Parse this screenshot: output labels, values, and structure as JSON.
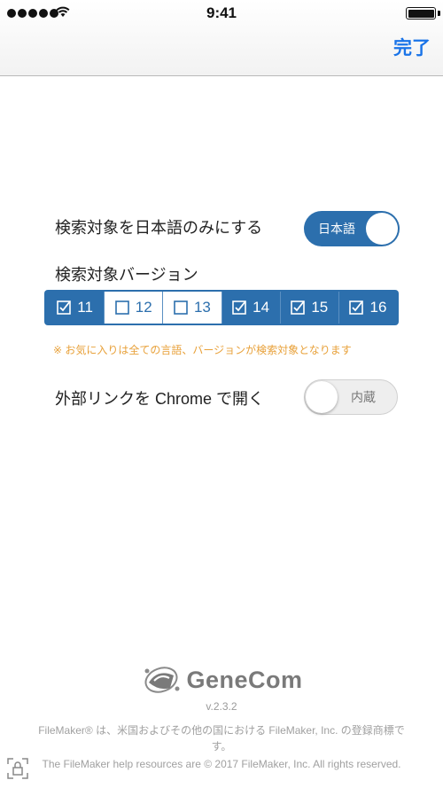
{
  "status_bar": {
    "time": "9:41"
  },
  "nav": {
    "done_label": "完了"
  },
  "settings": {
    "japanese_only": {
      "label": "検索対象を日本語のみにする",
      "toggle_text": "日本語",
      "state": "on"
    },
    "versions": {
      "label": "検索対象バージョン",
      "items": [
        {
          "label": "11",
          "checked": true
        },
        {
          "label": "12",
          "checked": false
        },
        {
          "label": "13",
          "checked": false
        },
        {
          "label": "14",
          "checked": true
        },
        {
          "label": "15",
          "checked": true
        },
        {
          "label": "16",
          "checked": true
        }
      ]
    },
    "note": "※ お気に入りは全ての言語、バージョンが検索対象となります",
    "external_links": {
      "label": "外部リンクを Chrome で開く",
      "toggle_text": "内蔵",
      "state": "off"
    }
  },
  "footer": {
    "logo": "GeneCom",
    "version": "v.2.3.2",
    "trademark": "FileMaker® は、米国およびその他の国における FileMaker, Inc. の登録商標です。",
    "copyright": "The FileMaker help resources are © 2017 FileMaker, Inc. All rights reserved."
  },
  "colors": {
    "accent_blue": "#2c6fad",
    "link_blue": "#1a74e8",
    "note_orange": "#e8a13a"
  }
}
